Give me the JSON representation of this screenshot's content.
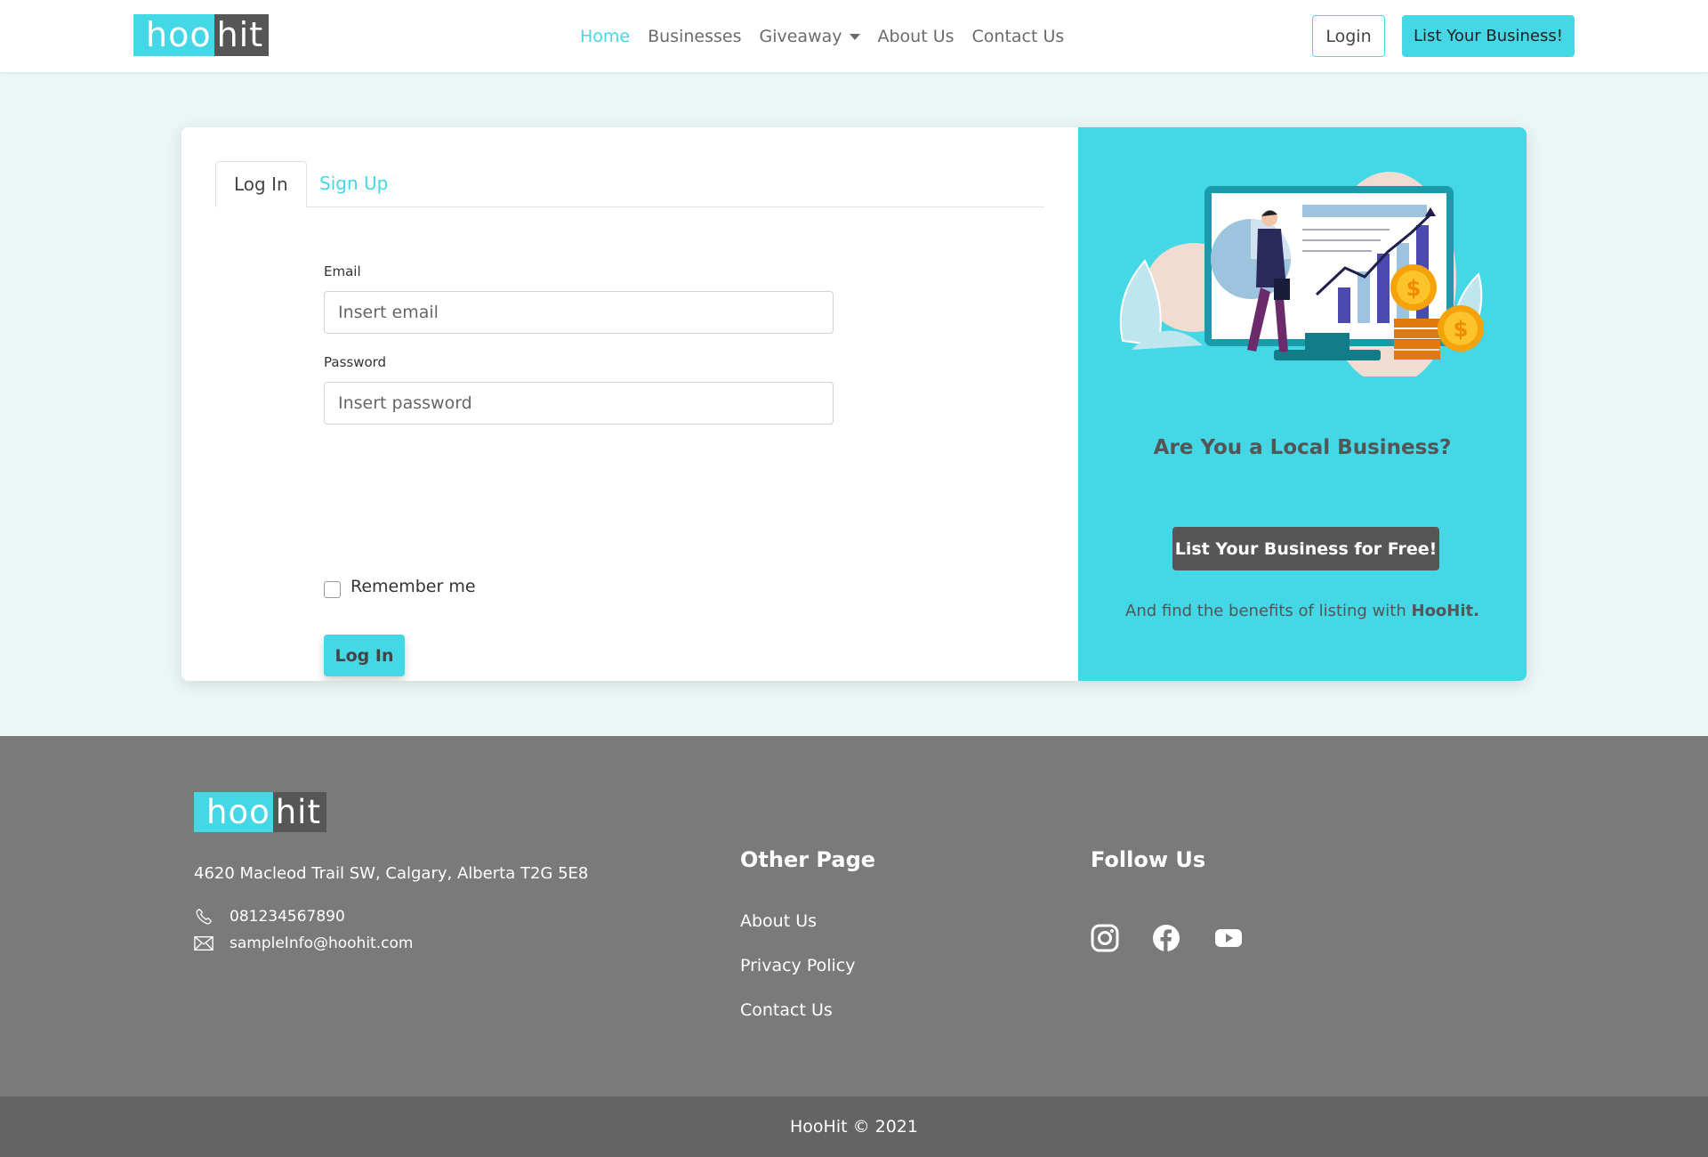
{
  "brand": {
    "logo_part1": "hoo",
    "logo_part2": "hit",
    "accent_color": "#44d7e5",
    "dark_color": "#565656"
  },
  "nav": {
    "items": [
      {
        "label": "Home",
        "active": true
      },
      {
        "label": "Businesses",
        "active": false
      },
      {
        "label": "Giveaway",
        "active": false,
        "dropdown": true
      },
      {
        "label": "About Us",
        "active": false
      },
      {
        "label": "Contact Us",
        "active": false
      }
    ],
    "login_label": "Login",
    "list_business_label": "List Your Business!"
  },
  "auth": {
    "tabs": [
      {
        "label": "Log In",
        "active": true
      },
      {
        "label": "Sign Up",
        "active": false
      }
    ],
    "email_label": "Email",
    "email_placeholder": "Insert email",
    "password_label": "Password",
    "password_placeholder": "Insert password",
    "remember_label": "Remember me",
    "submit_label": "Log In"
  },
  "cta": {
    "heading": "Are You a Local Business?",
    "button_label": "List Your Business for Free!",
    "note_prefix": "And find the benefits of listing with ",
    "note_brand": "HooHit."
  },
  "footer": {
    "address": "4620 Macleod Trail SW, Calgary, Alberta T2G 5E8",
    "phone": "081234567890",
    "email": "sampleInfo@hoohit.com",
    "other_page_heading": "Other Page",
    "other_page_links": [
      "About Us",
      "Privacy Policy",
      "Contact Us"
    ],
    "follow_heading": "Follow Us",
    "social_icons": [
      "instagram-icon",
      "facebook-icon",
      "youtube-icon"
    ],
    "copyright": "HooHit © 2021"
  }
}
